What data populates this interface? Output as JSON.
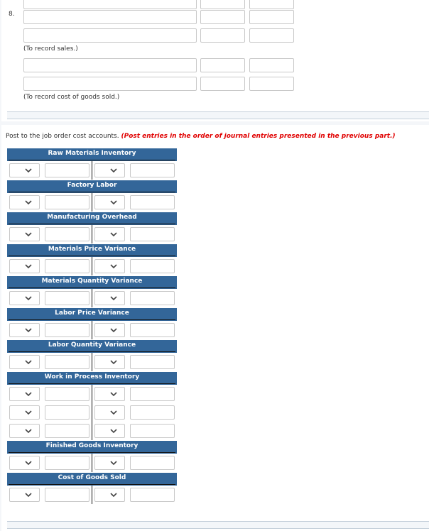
{
  "journal": {
    "entry_number": "8.",
    "notes": {
      "sales": "(To record sales.)",
      "cogs": "(To record cost of goods sold.)"
    }
  },
  "posting": {
    "instruction": "Post to the job order cost accounts.",
    "instruction_emphasis": "(Post entries in the order of journal entries presented in the previous part.)",
    "accounts": [
      {
        "title": "Raw Materials Inventory",
        "rows": 1
      },
      {
        "title": "Factory Labor",
        "rows": 1
      },
      {
        "title": "Manufacturing Overhead",
        "rows": 1
      },
      {
        "title": "Materials Price Variance",
        "rows": 1
      },
      {
        "title": "Materials Quantity Variance",
        "rows": 1
      },
      {
        "title": "Labor Price Variance",
        "rows": 1
      },
      {
        "title": "Labor Quantity Variance",
        "rows": 1
      },
      {
        "title": "Work in Process Inventory",
        "rows": 3
      },
      {
        "title": "Finished Goods Inventory",
        "rows": 1
      },
      {
        "title": "Cost of Goods Sold",
        "rows": 1
      }
    ]
  },
  "colors": {
    "header_blue": "#336699",
    "emphasis_red": "#e00000"
  }
}
